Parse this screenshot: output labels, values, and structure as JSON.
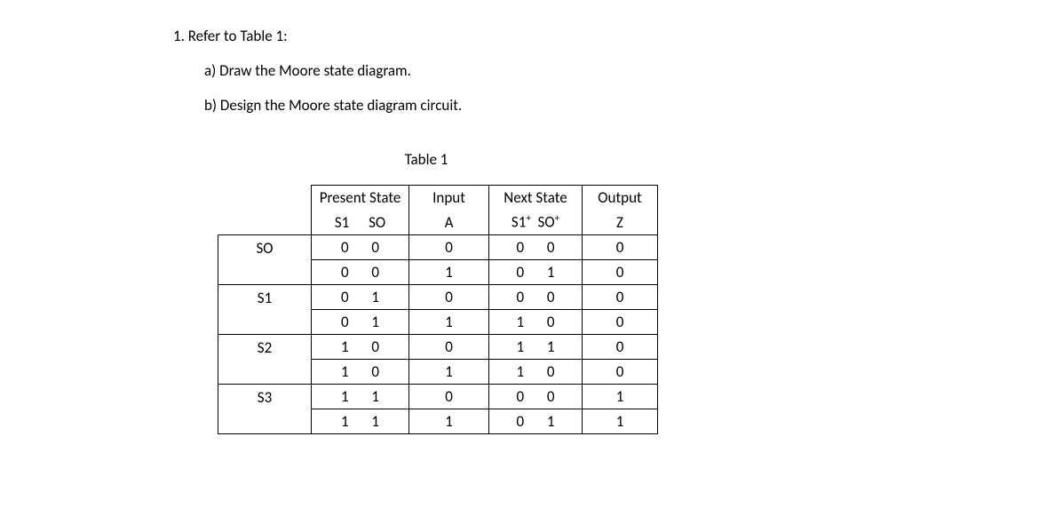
{
  "question": {
    "number": "1. Refer to Table 1:",
    "a": "a) Draw the Moore state diagram.",
    "b": "b) Design the Moore state diagram circuit."
  },
  "caption": "Table 1",
  "headers": {
    "present_state": "Present State",
    "ps_sub": "S1     SO",
    "input": "Input",
    "input_sub": "A",
    "next_state": "Next State",
    "ns_sub_s1": "S1",
    "ns_sub_s0": "SO",
    "output": "Output",
    "output_sub": "Z"
  },
  "rows": [
    {
      "group": "SO",
      "ps": "0 0",
      "a": "0",
      "ns": "0 0",
      "z": "0"
    },
    {
      "group": "",
      "ps": "0 0",
      "a": "1",
      "ns": "0 1",
      "z": "0"
    },
    {
      "group": "S1",
      "ps": "0 1",
      "a": "0",
      "ns": "0 0",
      "z": "0"
    },
    {
      "group": "",
      "ps": "0 1",
      "a": "1",
      "ns": "1 0",
      "z": "0"
    },
    {
      "group": "S2",
      "ps": "1 0",
      "a": "0",
      "ns": "1 1",
      "z": "0"
    },
    {
      "group": "",
      "ps": "1 0",
      "a": "1",
      "ns": "1 0",
      "z": "0"
    },
    {
      "group": "S3",
      "ps": "1 1",
      "a": "0",
      "ns": "0 0",
      "z": "1"
    },
    {
      "group": "",
      "ps": "1 1",
      "a": "1",
      "ns": "0 1",
      "z": "1"
    }
  ]
}
